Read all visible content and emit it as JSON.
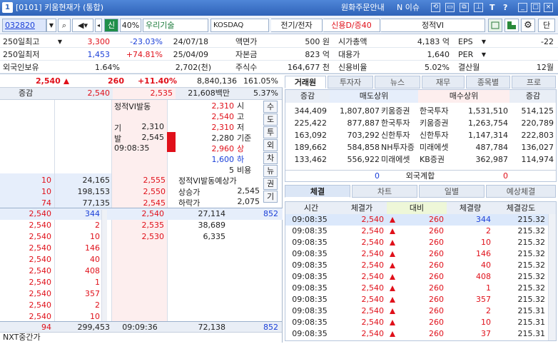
{
  "title_bar": {
    "badge": "1",
    "title": "[0101] 키움현재가 (통합)",
    "won_order": "원화주문안내",
    "issue": "N 이슈",
    "icons": [
      "T",
      "?"
    ]
  },
  "toolbar": {
    "code": "032820",
    "market_tag": "신",
    "margin": "40%",
    "name": "우리기술",
    "market": "KOSDAQ",
    "sector": "전기/전자",
    "credit": "신용D/증40",
    "status": "정적VI",
    "btn_right": "단"
  },
  "info_rows": [
    {
      "label": "250일최고",
      "v1": "3,300",
      "v2": "-23.03%",
      "v3": "24/07/18",
      "l2": "액면가",
      "v4": "500 원",
      "l3": "시가총액",
      "v5": "4,183 억",
      "l4": "EPS",
      "v6": "-22"
    },
    {
      "label": "250일최저",
      "v1": "1,453",
      "v2": "+74.81%",
      "v3": "25/04/09",
      "l2": "자본금",
      "v4": "823 억",
      "l3": "대용가",
      "v5": "1,640",
      "l4": "PER",
      "v6": ""
    },
    {
      "label": "외국인보유",
      "v1": "1.64%",
      "v2": "",
      "v3": "2,702(천)",
      "l2": "주식수",
      "v4": "164,677 천",
      "l3": "신용비율",
      "v5": "5.02%",
      "l4": "결산월",
      "v6": "12월"
    }
  ],
  "summary": {
    "price": "2,540",
    "change": "260",
    "rate": "+11.40%",
    "volume": "8,840,136",
    "ratio": "161.05%"
  },
  "ob_header": {
    "label": "증감",
    "sell_total": "2,540",
    "buy_total": "2,535",
    "amount": "21,608백만",
    "pct": "5.37%"
  },
  "vi_box": {
    "title": "정적VI발동",
    "ki_label": "기",
    "ki_val": "2,310",
    "bal_label": "발",
    "bal_val": "2,545",
    "time": "09:08:35"
  },
  "price_info": [
    {
      "val": "2,310",
      "lab": "시",
      "col": "red"
    },
    {
      "val": "2,540",
      "lab": "고",
      "col": "red"
    },
    {
      "val": "2,310",
      "lab": "저",
      "col": "red"
    },
    {
      "val": "2,280",
      "lab": "기준",
      "col": "dark"
    },
    {
      "val": "2,960",
      "lab": "상",
      "col": "red"
    },
    {
      "val": "1,600",
      "lab": "하",
      "col": "blue"
    },
    {
      "val": "5",
      "lab": "비용",
      "col": "dark"
    }
  ],
  "side_buttons": [
    "수",
    "도",
    "투",
    "외",
    "차",
    "뉴",
    "권",
    "기"
  ],
  "asks": [
    {
      "chg": "10",
      "qty": "24,165",
      "price": "2,555"
    },
    {
      "chg": "10",
      "qty": "198,153",
      "price": "2,550"
    },
    {
      "chg": "74",
      "qty": "77,135",
      "price": "2,545"
    }
  ],
  "vi_expect": {
    "title": "정적VI발동예상가",
    "up_label": "상승가",
    "up_val": "2,545",
    "down_label": "하락가",
    "down_val": "2,075"
  },
  "bids": [
    {
      "price": "2,530",
      "qty": "27,114",
      "chg": "852"
    },
    {
      "price": "",
      "qty": "38,689",
      "chg": ""
    },
    {
      "price": "",
      "qty": "6,335",
      "chg": ""
    }
  ],
  "bid_prices": [
    "2,540",
    "2,535",
    "2,530"
  ],
  "trades_left": [
    {
      "p": "2,540",
      "q": "344"
    },
    {
      "p": "2,540",
      "q": "2"
    },
    {
      "p": "2,540",
      "q": "10"
    },
    {
      "p": "2,540",
      "q": "146"
    },
    {
      "p": "2,540",
      "q": "40"
    },
    {
      "p": "2,540",
      "q": "408"
    },
    {
      "p": "2,540",
      "q": "1"
    },
    {
      "p": "2,540",
      "q": "357"
    },
    {
      "p": "2,540",
      "q": "2"
    },
    {
      "p": "2,540",
      "q": "10"
    }
  ],
  "ob_footer": {
    "chg": "94",
    "sell_sum": "299,453",
    "time": "09:09:36",
    "buy_sum": "72,138",
    "bchg": "852",
    "label": "NXT중간가"
  },
  "right_tabs": [
    "거래원",
    "투자자",
    "뉴스",
    "재무",
    "종목별",
    "프로"
  ],
  "broker_header": {
    "c1": "증감",
    "c2": "매도상위",
    "c3": "매수상위",
    "c4": "증감"
  },
  "brokers": [
    {
      "sc": "344,409",
      "sq": "1,807,807",
      "sn": "키움증권",
      "bn": "한국투자",
      "bq": "1,531,510",
      "bc": "514,125"
    },
    {
      "sc": "225,422",
      "sq": "877,887",
      "sn": "한국투자",
      "bn": "키움증권",
      "bq": "1,263,754",
      "bc": "220,789"
    },
    {
      "sc": "163,092",
      "sq": "703,292",
      "sn": "신한투자",
      "bn": "신한투자",
      "bq": "1,147,314",
      "bc": "222,803"
    },
    {
      "sc": "189,662",
      "sq": "584,858",
      "sn": "NH투자증",
      "bn": "미래에셋",
      "bq": "487,784",
      "bc": "136,027"
    },
    {
      "sc": "133,462",
      "sq": "556,922",
      "sn": "미래에셋",
      "bn": "KB증권",
      "bq": "362,987",
      "bc": "114,974"
    }
  ],
  "foreign_total": {
    "left": "0",
    "label": "외국계합",
    "right": "0"
  },
  "tick_tabs": [
    "체결",
    "차트",
    "일별",
    "예상체결"
  ],
  "tick_header": {
    "time": "시간",
    "price": "체결가",
    "diff": "대비",
    "qty": "체결량",
    "strength": "체결강도"
  },
  "ticks": [
    {
      "t": "09:08:35",
      "p": "2,540",
      "d": "260",
      "q": "344",
      "s": "215.32",
      "col": "blue"
    },
    {
      "t": "09:08:35",
      "p": "2,540",
      "d": "260",
      "q": "2",
      "s": "215.32",
      "col": "red"
    },
    {
      "t": "09:08:35",
      "p": "2,540",
      "d": "260",
      "q": "10",
      "s": "215.32",
      "col": "red"
    },
    {
      "t": "09:08:35",
      "p": "2,540",
      "d": "260",
      "q": "146",
      "s": "215.32",
      "col": "red"
    },
    {
      "t": "09:08:35",
      "p": "2,540",
      "d": "260",
      "q": "40",
      "s": "215.32",
      "col": "red"
    },
    {
      "t": "09:08:35",
      "p": "2,540",
      "d": "260",
      "q": "408",
      "s": "215.32",
      "col": "red"
    },
    {
      "t": "09:08:35",
      "p": "2,540",
      "d": "260",
      "q": "1",
      "s": "215.32",
      "col": "red"
    },
    {
      "t": "09:08:35",
      "p": "2,540",
      "d": "260",
      "q": "357",
      "s": "215.32",
      "col": "red"
    },
    {
      "t": "09:08:35",
      "p": "2,540",
      "d": "260",
      "q": "2",
      "s": "215.31",
      "col": "red"
    },
    {
      "t": "09:08:35",
      "p": "2,540",
      "d": "260",
      "q": "10",
      "s": "215.31",
      "col": "red"
    },
    {
      "t": "09:08:35",
      "p": "2,540",
      "d": "260",
      "q": "37",
      "s": "215.31",
      "col": "red"
    }
  ]
}
